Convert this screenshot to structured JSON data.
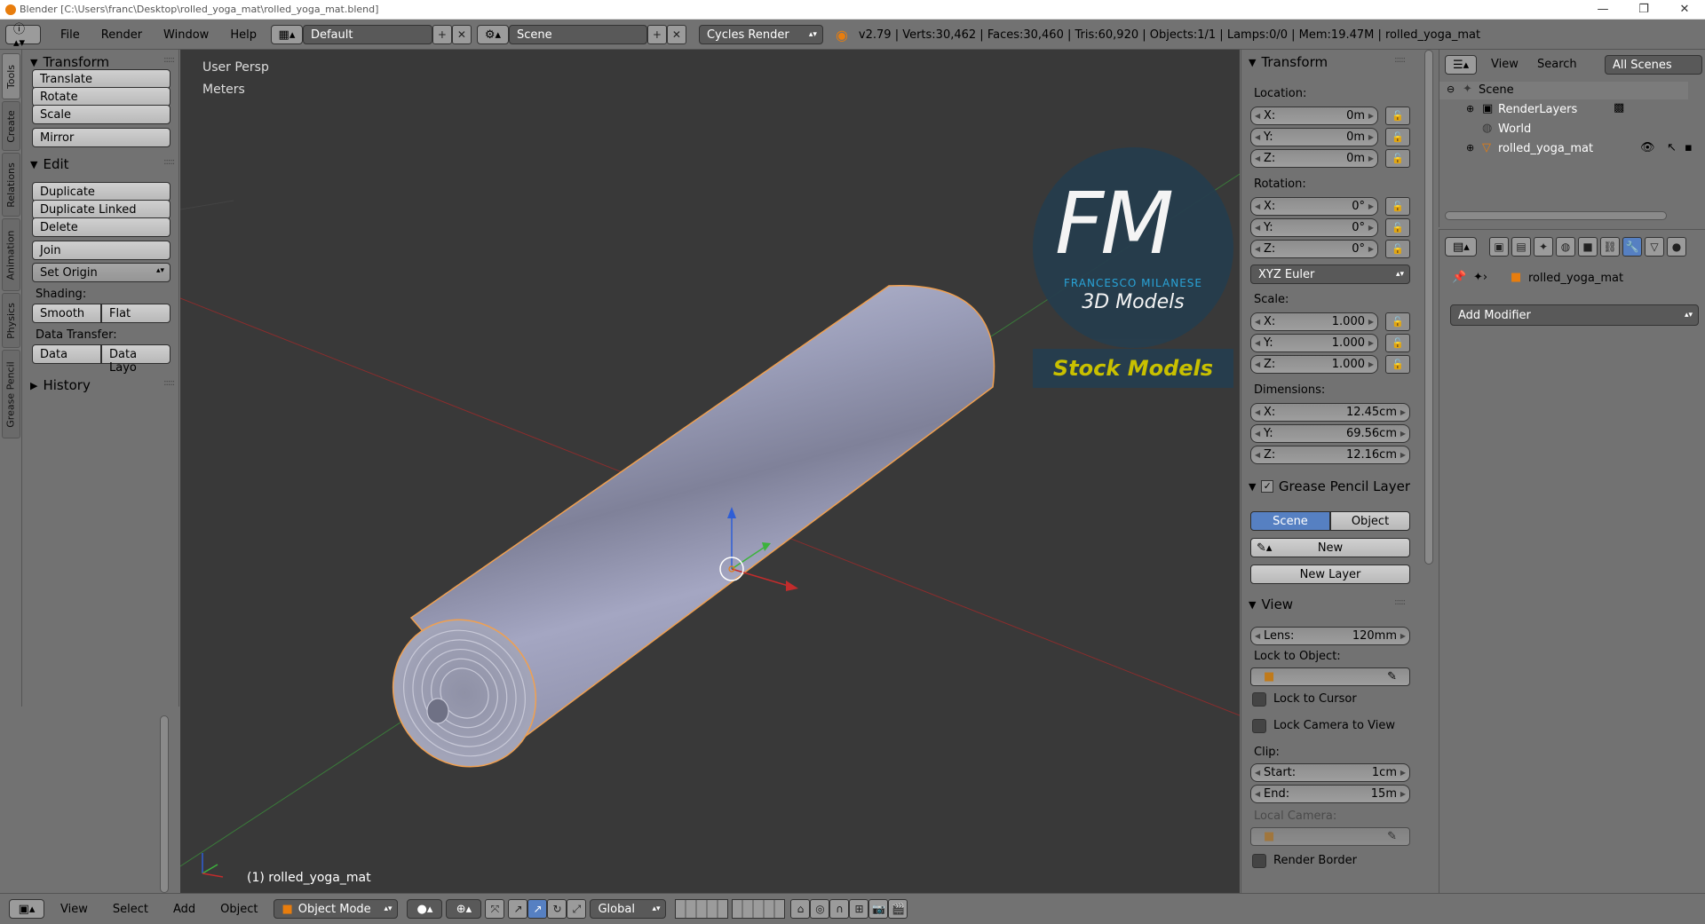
{
  "window": {
    "title": "Blender [C:\\Users\\franc\\Desktop\\rolled_yoga_mat\\rolled_yoga_mat.blend]"
  },
  "menu": [
    "File",
    "Render",
    "Window",
    "Help"
  ],
  "header": {
    "layout": "Default",
    "scene": "Scene",
    "engine": "Cycles Render",
    "stats": "v2.79 | Verts:30,462 | Faces:30,460 | Tris:60,920 | Objects:1/1 | Lamps:0/0 | Mem:19.47M | rolled_yoga_mat"
  },
  "side_tabs": [
    "Tools",
    "Create",
    "Relations",
    "Animation",
    "Physics",
    "Grease Pencil"
  ],
  "tools": {
    "transform_title": "Transform",
    "translate": "Translate",
    "rotate": "Rotate",
    "scale": "Scale",
    "mirror": "Mirror",
    "edit_title": "Edit",
    "duplicate": "Duplicate",
    "duplicate_linked": "Duplicate Linked",
    "delete": "Delete",
    "join": "Join",
    "set_origin": "Set Origin",
    "shading_label": "Shading:",
    "smooth": "Smooth",
    "flat": "Flat",
    "data_transfer_label": "Data Transfer:",
    "data": "Data",
    "data_layo": "Data Layo",
    "history": "History"
  },
  "viewport": {
    "view_name": "User Persp",
    "units": "Meters",
    "object_label": "(1) rolled_yoga_mat",
    "watermark_fm": "FM",
    "watermark_name": "FRANCESCO MILANESE",
    "watermark_3d": "3D Models",
    "watermark_stock": "Stock Models"
  },
  "npanel": {
    "transform_title": "Transform",
    "location_label": "Location:",
    "location": [
      {
        "axis": "X:",
        "value": "0m"
      },
      {
        "axis": "Y:",
        "value": "0m"
      },
      {
        "axis": "Z:",
        "value": "0m"
      }
    ],
    "rotation_label": "Rotation:",
    "rotation": [
      {
        "axis": "X:",
        "value": "0°"
      },
      {
        "axis": "Y:",
        "value": "0°"
      },
      {
        "axis": "Z:",
        "value": "0°"
      }
    ],
    "rotation_mode": "XYZ Euler",
    "scale_label": "Scale:",
    "scale": [
      {
        "axis": "X:",
        "value": "1.000"
      },
      {
        "axis": "Y:",
        "value": "1.000"
      },
      {
        "axis": "Z:",
        "value": "1.000"
      }
    ],
    "dimensions_label": "Dimensions:",
    "dimensions": [
      {
        "axis": "X:",
        "value": "12.45cm"
      },
      {
        "axis": "Y:",
        "value": "69.56cm"
      },
      {
        "axis": "Z:",
        "value": "12.16cm"
      }
    ],
    "gp_title": "Grease Pencil Layer",
    "gp_scene": "Scene",
    "gp_object": "Object",
    "gp_new": "New",
    "gp_new_layer": "New Layer",
    "view_title": "View",
    "lens_label": "Lens:",
    "lens_value": "120mm",
    "lock_to_object": "Lock to Object:",
    "lock_to_cursor": "Lock to Cursor",
    "lock_camera": "Lock Camera to View",
    "clip_label": "Clip:",
    "clip_start_label": "Start:",
    "clip_start": "1cm",
    "clip_end_label": "End:",
    "clip_end": "15m",
    "local_camera": "Local Camera:",
    "render_border": "Render Border"
  },
  "outliner": {
    "view": "View",
    "search": "Search",
    "all_scenes": "All Scenes",
    "items": [
      "Scene",
      "RenderLayers",
      "World",
      "rolled_yoga_mat"
    ]
  },
  "properties": {
    "object_name": "rolled_yoga_mat",
    "add_modifier": "Add Modifier"
  },
  "bottom": {
    "view": "View",
    "select": "Select",
    "add": "Add",
    "object": "Object",
    "mode": "Object Mode",
    "orientation": "Global"
  },
  "colors": {
    "accent": "#5680c2",
    "selection_outline": "#f0a050",
    "watermark_blue": "#29a9e0",
    "watermark_yellow": "#c8c000"
  }
}
